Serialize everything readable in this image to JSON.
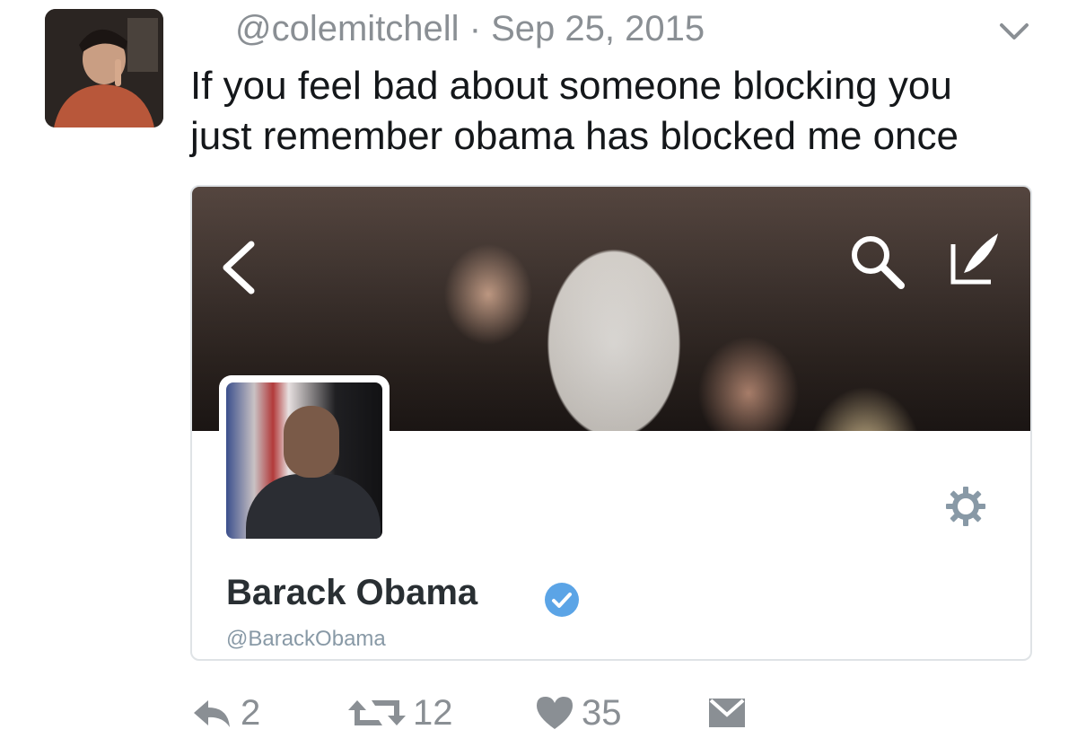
{
  "tweet": {
    "handle": "@colemitchell",
    "separator": " · ",
    "date": "Sep 25, 2015",
    "text_line1": "If you feel bad about someone blocking you",
    "text_line2": "just remember obama has blocked me once"
  },
  "embedded_profile": {
    "name": "Barack Obama",
    "handle": "@BarackObama",
    "verified": true
  },
  "actions": {
    "reply_count": "2",
    "retweet_count": "12",
    "like_count": "35"
  },
  "colors": {
    "text": "#14171a",
    "muted": "#8a8f94",
    "verified_blue": "#5ba4e6"
  },
  "icons": [
    "chevron-down-icon",
    "back-arrow-icon",
    "search-icon",
    "compose-icon",
    "gear-icon",
    "verified-badge-icon",
    "reply-icon",
    "retweet-icon",
    "heart-icon",
    "message-icon"
  ]
}
